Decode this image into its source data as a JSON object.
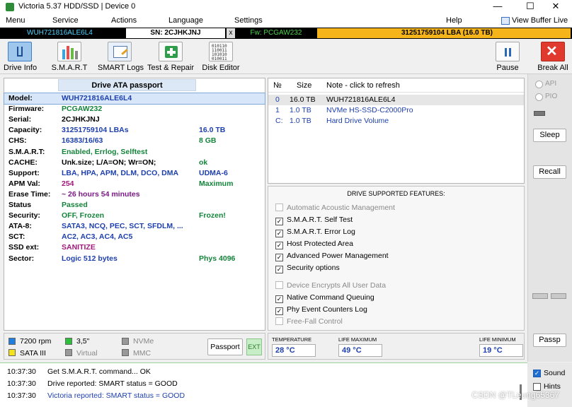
{
  "window": {
    "title": "Victoria 5.37 HDD/SSD | Device 0",
    "controls": [
      "—",
      "☐",
      "✕"
    ]
  },
  "menu": {
    "items": [
      "Menu",
      "Service",
      "Actions",
      "Language",
      "Settings",
      "Help"
    ],
    "view_buffer": "View Buffer Live"
  },
  "drivebar": {
    "model": "WUH721816ALE6L4",
    "serial": "SN: 2CJHKJNJ",
    "close": "x",
    "firmware": "Fw: PCGAW232",
    "lba": "31251759104 LBA (16.0 TB)"
  },
  "toolbar": {
    "buttons": [
      "Drive Info",
      "S.M.A.R.T",
      "SMART Logs",
      "Test & Repair",
      "Disk Editor"
    ],
    "pause": "Pause",
    "break_all": "Break All"
  },
  "passport": {
    "header": "Drive ATA passport",
    "rows": [
      {
        "label": "Model:",
        "value": "WUH721816ALE6L4",
        "extra": "",
        "color": "#1d3fae"
      },
      {
        "label": "Firmware:",
        "value": "PCGAW232",
        "extra": "",
        "color": "#13843a"
      },
      {
        "label": "Serial:",
        "value": "2CJHKJNJ",
        "extra": "",
        "color": "#000000"
      },
      {
        "label": "Capacity:",
        "value": "31251759104 LBAs",
        "extra": "16.0 TB",
        "color": "#1d3fae"
      },
      {
        "label": "CHS:",
        "value": "16383/16/63",
        "extra": "8 GB",
        "color": "#1d3fae"
      },
      {
        "label": "S.M.A.R.T:",
        "value": "Enabled, Errlog, Selftest",
        "extra": "",
        "color": "#13843a"
      },
      {
        "label": "CACHE:",
        "value": "Unk.size; L/A=ON; Wr=ON;",
        "extra": "ok",
        "color": "#000000"
      },
      {
        "label": "Support:",
        "value": "LBA, HPA, APM, DLM, DCO, DMA",
        "extra": "UDMA-6",
        "color": "#1d3fae"
      },
      {
        "label": "APM Val:",
        "value": "254",
        "extra": "Maximum",
        "color": "#a0197a"
      },
      {
        "label": "Erase Time:",
        "value": "~ 26 hours 54 minutes",
        "extra": "",
        "color": "#7a1a86"
      },
      {
        "label": "Status",
        "value": "Passed",
        "extra": "",
        "color": "#13843a"
      },
      {
        "label": "Security:",
        "value": "OFF, Frozen",
        "extra": "Frozen!",
        "color": "#13843a"
      },
      {
        "label": "ATA-8:",
        "value": "SATA3, NCQ, PEC, SCT, SFDLM, ...",
        "extra": "",
        "color": "#1d3fae"
      },
      {
        "label": "SCT:",
        "value": "AC2, AC3, AC4, AC5",
        "extra": "",
        "color": "#1d3fae"
      },
      {
        "label": "SSD ext:",
        "value": "SANITIZE",
        "extra": "",
        "color": "#a0197a"
      },
      {
        "label": "Sector:",
        "value": "Logic 512 bytes",
        "extra": "Phys 4096",
        "color": "#1d3fae"
      }
    ]
  },
  "drivelist": {
    "headers": [
      "№",
      "Size",
      "Note - click to refresh"
    ],
    "rows": [
      {
        "num": "0",
        "size": "16.0 TB",
        "note": "WUH721816ALE6L4"
      },
      {
        "num": "1",
        "size": "1.0 TB",
        "note": "NVMe    HS-SSD-C2000Pro"
      },
      {
        "num": "C:",
        "size": "1.0 TB",
        "note": "Hard Drive Volume"
      }
    ]
  },
  "features": {
    "title": "DRIVE SUPPORTED FEATURES:",
    "items": [
      {
        "label": "Automatic Acoustic Management",
        "checked": false,
        "enabled": false
      },
      {
        "label": "S.M.A.R.T. Self Test",
        "checked": true,
        "enabled": true
      },
      {
        "label": "S.M.A.R.T. Error Log",
        "checked": true,
        "enabled": true
      },
      {
        "label": "Host Protected Area",
        "checked": true,
        "enabled": true
      },
      {
        "label": "Advanced Power Management",
        "checked": true,
        "enabled": true
      },
      {
        "label": "Security options",
        "checked": true,
        "enabled": true
      },
      {
        "label": "Device Encrypts All User Data",
        "checked": false,
        "enabled": false
      },
      {
        "label": "Native Command Queuing",
        "checked": true,
        "enabled": true
      },
      {
        "label": "Phy Event Counters Log",
        "checked": true,
        "enabled": true
      },
      {
        "label": "Free-Fall Control",
        "checked": false,
        "enabled": false
      }
    ]
  },
  "rightctrl": {
    "api": "API",
    "pio": "PIO",
    "sleep": "Sleep",
    "recall": "Recall",
    "passp": "Passp"
  },
  "bottominfo": {
    "rpm": "7200 rpm",
    "form": "3,5\"",
    "nvme": "NVMe",
    "sata": "SATA III",
    "virtual": "Virtual",
    "mmc": "MMC",
    "passport_btn": "Passport",
    "ext_btn": "EXT"
  },
  "temps": {
    "temperature_label": "TEMPERATURE",
    "temperature": "28 °C",
    "life_max_label": "LIFE MAXIMUM",
    "life_max": "49 °C",
    "life_min_label": "LIFE MINIMUM",
    "life_min": "19 °C"
  },
  "log": {
    "lines": [
      {
        "time": "10:37:30",
        "text": "Get S.M.A.R.T. command... OK",
        "color": "#000000"
      },
      {
        "time": "10:37:30",
        "text": "Drive reported: SMART status = GOOD",
        "color": "#000000"
      },
      {
        "time": "10:37:30",
        "text": "Victoria reported: SMART status = GOOD",
        "color": "#1d3fae"
      }
    ]
  },
  "logside": {
    "sound": "Sound",
    "hints": "Hints"
  },
  "watermark": "CSDN @TLeung65367"
}
